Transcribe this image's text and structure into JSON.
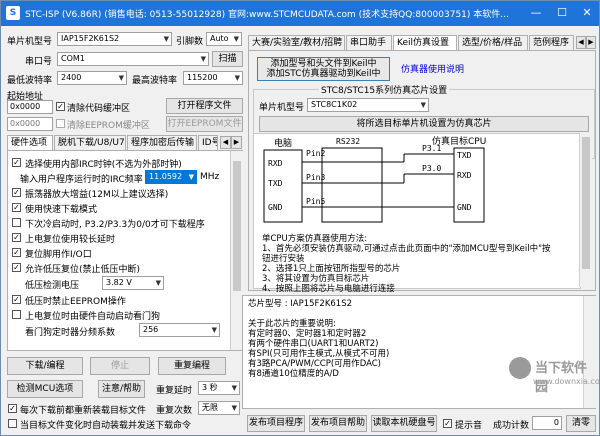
{
  "window": {
    "title": "STC-ISP (V6.86R) (销售电话: 0513-55012928) 官网:www.STCMCUDATA.com (技术支持QQ:800003751) 本软件...",
    "minimize": "—",
    "maximize": "☐",
    "close": "✕"
  },
  "left": {
    "mcu_model_label": "单片机型号",
    "mcu_model_value": "IAP15F2K61S2",
    "pins_label": "引脚数",
    "pins_value": "Auto",
    "port_label": "串口号",
    "port_value": "COM1",
    "scan_button": "扫描",
    "min_baud_label": "最低波特率",
    "min_baud_value": "2400",
    "max_baud_label": "最高波特率",
    "max_baud_value": "115200",
    "start_addr_label": "起始地址",
    "start_addr_1": "0x0000",
    "clear_code_label": "清除代码缓冲区",
    "open_program_button": "打开程序文件",
    "start_addr_2": "0x0000",
    "clear_eeprom_label": "清除EEPROM缓冲区",
    "open_eeprom_button": "打开EEPROM文件"
  },
  "hw_tabs": [
    "硬件选项",
    "脱机下载/U8/U7",
    "程序加密后传输",
    "ID号"
  ],
  "hw_tab_nav": [
    "◀",
    "▶"
  ],
  "options": {
    "opt1": "选择使用内部IRC时钟(不选为外部时钟)",
    "freq_label": "输入用户程序运行时的IRC频率",
    "freq_value": "11.0592",
    "freq_unit": "MHz",
    "opt2": "振荡器放大增益(12M以上建议选择)",
    "opt3": "使用快速下载模式",
    "opt4": "下次冷启动时, P3.2/P3.3为0/0才可下载程序",
    "opt5": "上电复位使用较长延时",
    "opt6": "复位脚用作I/O口",
    "opt7": "允许低压复位(禁止低压中断)",
    "lv_label": "低压检测电压",
    "lv_value": "3.82 V",
    "opt8": "低压时禁止EEPROM操作",
    "opt9": "上电复位时由硬件自动启动看门狗",
    "wdt_label": "看门狗定时器分频系数",
    "wdt_value": "256"
  },
  "bottom_left": {
    "download_button": "下载/编程",
    "stop_button": "停止",
    "reprogram_button": "重复编程",
    "check_button": "检测MCU选项",
    "help_button": "注意/帮助",
    "repeat_delay_label": "重复延时",
    "repeat_delay_value": "3 秒",
    "repeat_count_label": "重复次数",
    "repeat_count_value": "无限",
    "reload_label": "每次下载前都重新装载目标文件",
    "auto_send_label": "当目标文件变化时自动装载并发送下载命令"
  },
  "right_tabs": [
    "大赛/实验室/教材/招聘",
    "串口助手",
    "Keil仿真设置",
    "选型/价格/样品",
    "范例程序"
  ],
  "keil": {
    "add_button_line1": "添加型号和头文件到Keil中",
    "add_button_line2": "添加STC仿真器驱动到Keil中",
    "emu_doc_link": "仿真器使用说明",
    "group_title": "STC8/STC15系列仿真芯片设置",
    "mcu_label": "单片机型号",
    "mcu_value": "STC8C1K02",
    "set_button": "将所选目标单片机设置为仿真芯片"
  },
  "diagram": {
    "pc_title": "电脑",
    "rs232": "RS232",
    "cpu_title": "仿真目标CPU",
    "pc_pins": [
      "RXD",
      "TXD",
      "GND"
    ],
    "wires": [
      "Pin2",
      "Pin3",
      "Pin5"
    ],
    "cpu_port_labels": [
      "P3.1",
      "P3.0"
    ],
    "cpu_pins": [
      "TXD",
      "RXD",
      "GND"
    ]
  },
  "instructions": [
    "单CPU方案仿真器使用方法:",
    "1、首先必须安装仿真驱动,可通过点击此页面中的\"添加MCU型号到Keil中\"按",
    "钮进行安装",
    "2、选择1只上面按钮所指型号的芯片",
    "3、将其设置为仿真目标芯片",
    "4、按照上图将芯片与电脑进行连接"
  ],
  "chip_info": {
    "lines": [
      "芯片型号 : IAP15F2K61S2",
      "",
      "关于此芯片的重要说明:",
      "  有定时器0、定时器1和定时器2",
      "  有两个硬件串口(UART1和UART2)",
      "  有SPI(只可用作主模式,从模式不可用)",
      "  有3路PCA/PWM/CCP(可用作DAC)",
      "  有8通道10位精度的A/D"
    ]
  },
  "bottom_right": {
    "publish_button": "发布项目程序",
    "publish_help_button": "发布项目帮助",
    "read_disk_button": "读取本机硬盘号",
    "sound_label": "提示音",
    "success_label": "成功计数",
    "success_count": "0",
    "clear_button": "清零"
  },
  "watermark": {
    "name": "当下软件园",
    "url": "www.downxia.com"
  }
}
